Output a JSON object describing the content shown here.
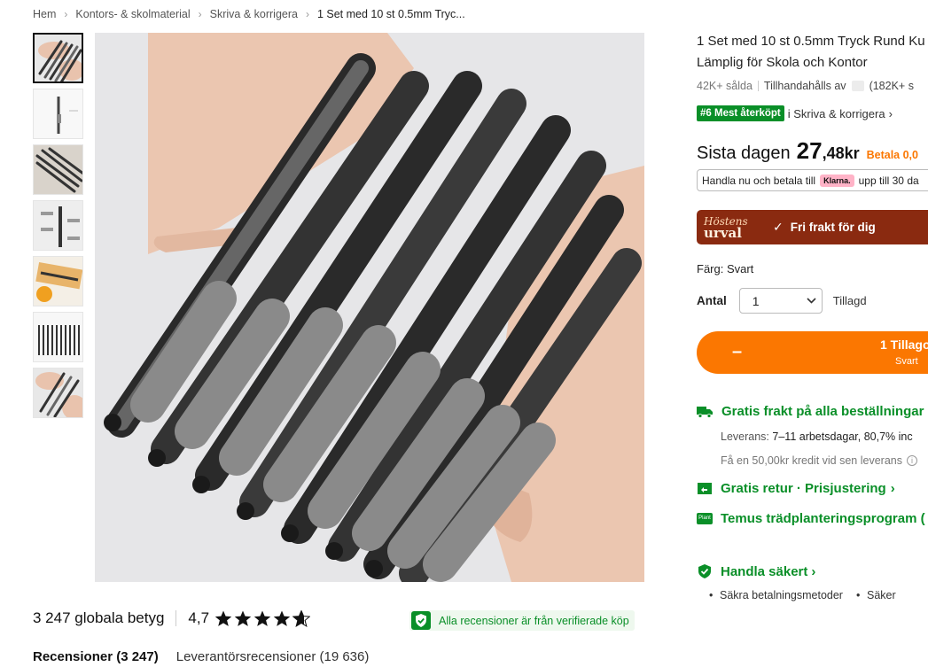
{
  "breadcrumb": {
    "items": [
      "Hem",
      "Kontors- & skolmaterial",
      "Skriva & korrigera",
      "1 Set med 10 st 0.5mm Tryc..."
    ]
  },
  "gallery": {
    "thumbnails": [
      "thumb-1",
      "thumb-2",
      "thumb-3",
      "thumb-4",
      "thumb-5",
      "thumb-6",
      "thumb-7"
    ],
    "active_index": 0
  },
  "product": {
    "title_line1": "1 Set med 10 st 0.5mm Tryck Rund Ku",
    "title_line2": "Lämplig för Skola och Kontor",
    "sold": "42K+ sålda",
    "supplier": "Tillhandahålls av",
    "supplier_count": "(182K+ s",
    "rank_badge": "#6 Mest återköpt",
    "rank_category": "i Skriva & korrigera",
    "price_label": "Sista dagen",
    "price_int": "27",
    "price_dec": ",48kr",
    "price_betala": "Betala 0,0",
    "klarna_text_before": "Handla nu och betala till",
    "klarna_logo": "Klarna.",
    "klarna_text_after": "upp till 30 da",
    "harvest_script": "Höstens",
    "harvest_word": "urval",
    "free_shipping": "Fri frakt för dig",
    "color_label": "Färg: Svart",
    "qty_label": "Antal",
    "qty_value": "1",
    "qty_added": "Tillagd",
    "cart_main": "1 Tillago",
    "cart_sub": "Svart",
    "cart_minus": "–"
  },
  "shipping": {
    "title": "Gratis frakt på alla beställningar",
    "delivery_label": "Leverans:",
    "delivery_value": "7–11 arbetsdagar, 80,7% inc",
    "credit": "Få en 50,00kr kredit vid sen leverans",
    "retur": "Gratis retur · Prisjustering",
    "plant": "Temus trädplanteringsprogram (",
    "plant_icon_text": "Plant",
    "safe": "Handla säkert",
    "bullet1": "Säkra betalningsmetoder",
    "bullet2": "Säker"
  },
  "reviews": {
    "global": "3 247 globala betyg",
    "score": "4,7",
    "stars": 4.7,
    "verified": "Alla recensioner är från verifierade köp",
    "tab1": "Recensioner (3 247)",
    "tab2": "Leverantörsrecensioner (19 636)"
  },
  "colors": {
    "accent": "#fb7701",
    "green": "#0a8f28",
    "harvest": "#8a2a10"
  }
}
